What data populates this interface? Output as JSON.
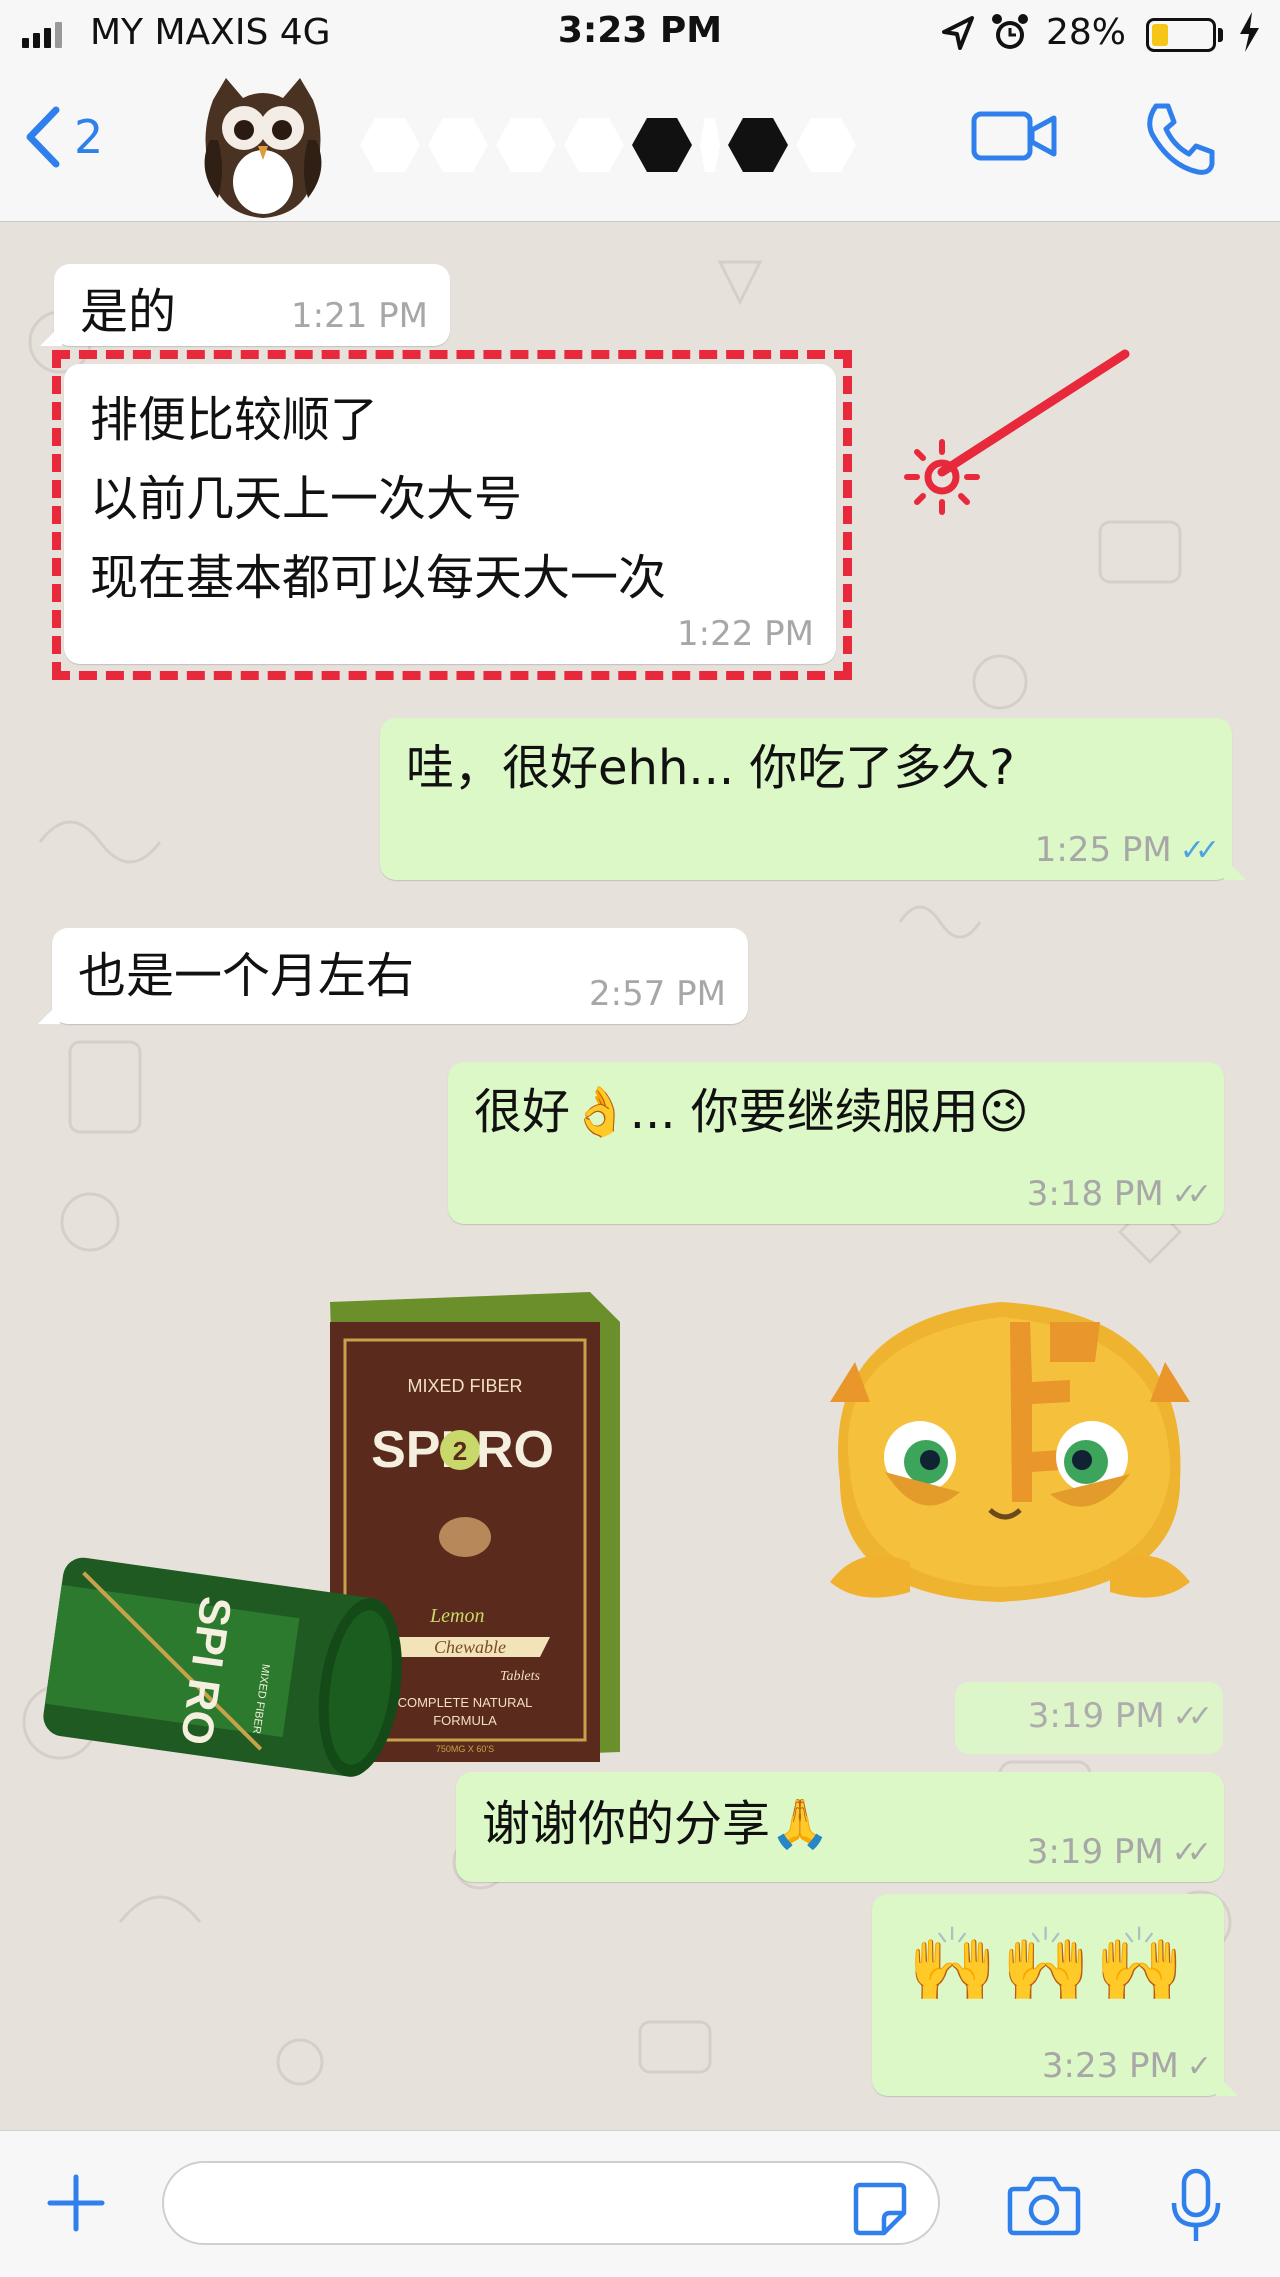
{
  "status_bar": {
    "carrier": "MY MAXIS 4G",
    "time": "3:23 PM",
    "battery": "28%",
    "battery_level": 0.28
  },
  "header": {
    "back_count": "2",
    "icons": [
      "back-chevron-icon",
      "owl-avatar",
      "video-call-icon",
      "phone-icon"
    ]
  },
  "messages": [
    {
      "direction": "in",
      "text": "是的",
      "time": "1:21 PM"
    },
    {
      "direction": "in",
      "lines": [
        "排便比较顺了",
        "以前几天上一次大号",
        "现在基本都可以每天大一次"
      ],
      "time": "1:22 PM",
      "highlighted": true
    },
    {
      "direction": "out",
      "text": "哇，很好ehh... 你吃了多久?",
      "time": "1:25 PM",
      "status": "read"
    },
    {
      "direction": "in",
      "text": "也是一个月左右",
      "time": "2:57 PM"
    },
    {
      "direction": "out",
      "text": "很好👌... 你要继续服用😉",
      "time": "3:18 PM",
      "status": "delivered"
    },
    {
      "direction": "out",
      "type": "sticker",
      "time": "3:19 PM",
      "status": "delivered"
    },
    {
      "direction": "out",
      "text": "谢谢你的分享🙏",
      "time": "3:19 PM",
      "status": "delivered"
    },
    {
      "direction": "out",
      "text": "🙌🙌🙌",
      "time": "3:23 PM",
      "status": "sent"
    }
  ],
  "product": {
    "box_top": "MIXED FIBER",
    "brand_left": "SPI",
    "brand_sup": "2",
    "brand_right": "RO",
    "flavor": "Lemon",
    "ribbon": "Chewable",
    "tablets": "Tablets",
    "formula_1": "COMPLETE NATURAL",
    "formula_2": "FORMULA",
    "count": "750MG X 60'S",
    "bottle_brand": "SPI RO",
    "bottle_side": "MIXED FIBER"
  },
  "input_bar": {
    "placeholder": "",
    "icons": [
      "plus-icon",
      "sticker-icon",
      "camera-icon",
      "microphone-icon"
    ]
  },
  "colors": {
    "incoming_bubble": "#ffffff",
    "outgoing_bubble": "#dcf8c6",
    "read_ticks": "#4fa3e2",
    "highlight_dash": "#e8283b",
    "ios_blue": "#2f80ed",
    "chat_bg": "#e7e1dc"
  }
}
